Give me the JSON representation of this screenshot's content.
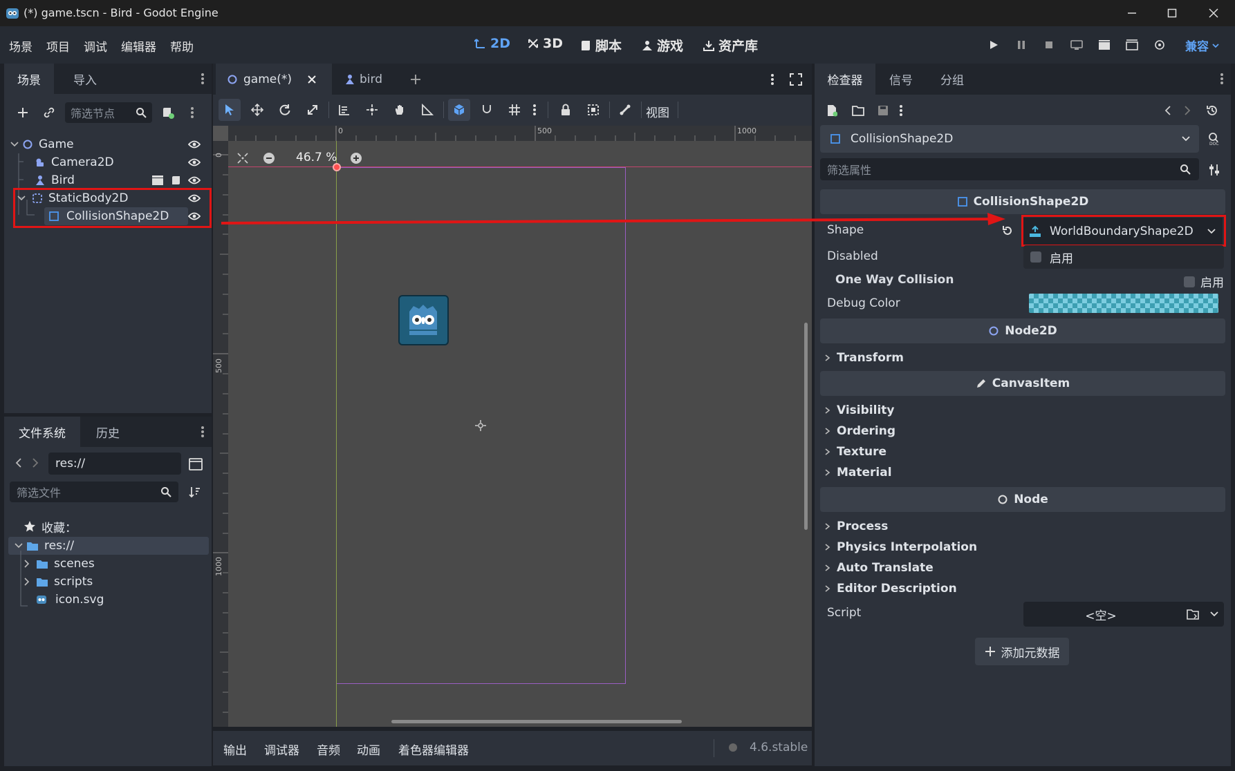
{
  "window": {
    "title": "(*) game.tscn - Bird - Godot Engine"
  },
  "menu": [
    "场景",
    "项目",
    "调试",
    "编辑器",
    "帮助"
  ],
  "workspaces": [
    {
      "label": "2D",
      "icon": "2d-icon",
      "active": true
    },
    {
      "label": "3D",
      "icon": "3d-icon",
      "active": false
    },
    {
      "label": "脚本",
      "icon": "script-icon",
      "active": false
    },
    {
      "label": "游戏",
      "icon": "game-icon",
      "active": false
    },
    {
      "label": "资产库",
      "icon": "assetlib-icon",
      "active": false
    }
  ],
  "renderer": "兼容",
  "scene_dock": {
    "tabs": [
      "场景",
      "导入"
    ],
    "filter_placeholder": "筛选节点",
    "nodes": [
      {
        "name": "Game",
        "icon": "node2d-icon"
      },
      {
        "name": "Camera2D",
        "icon": "camera2d-icon"
      },
      {
        "name": "Bird",
        "icon": "bird-scene-icon"
      },
      {
        "name": "StaticBody2D",
        "icon": "staticbody2d-icon"
      },
      {
        "name": "CollisionShape2D",
        "icon": "collisionshape2d-icon"
      }
    ]
  },
  "filesystem": {
    "tabs": [
      "文件系统",
      "历史"
    ],
    "path": "res://",
    "filter_placeholder": "筛选文件",
    "favorites": "收藏：",
    "items": [
      {
        "name": "res://",
        "type": "folder"
      },
      {
        "name": "scenes",
        "type": "folder"
      },
      {
        "name": "scripts",
        "type": "folder"
      },
      {
        "name": "icon.svg",
        "type": "file"
      }
    ]
  },
  "editor": {
    "tabs": [
      "game(*)",
      "bird"
    ],
    "view_menu": "视图",
    "zoom": "46.7 %",
    "ruler_top": [
      "0",
      "500",
      "1000"
    ],
    "ruler_left": [
      "0",
      "500",
      "1000"
    ],
    "bottom_tabs": [
      "输出",
      "调试器",
      "音频",
      "动画",
      "着色器编辑器"
    ],
    "version": "4.6.stable"
  },
  "inspector": {
    "tabs": [
      "检查器",
      "信号",
      "分组"
    ],
    "node_type": "CollisionShape2D",
    "filter_placeholder": "筛选属性",
    "sections": {
      "collision": "CollisionShape2D",
      "node2d": "Node2D",
      "canvasitem": "CanvasItem",
      "node": "Node"
    },
    "props": {
      "shape_label": "Shape",
      "shape_value": "WorldBoundaryShape2D",
      "disabled_label": "Disabled",
      "disabled_value": "启用",
      "oneway_label": "One Way Collision",
      "oneway_value": "启用",
      "debug_label": "Debug Color",
      "script_label": "Script",
      "script_value": "<空>"
    },
    "groups_node2d": [
      "Transform"
    ],
    "groups_canvas": [
      "Visibility",
      "Ordering",
      "Texture",
      "Material"
    ],
    "groups_node": [
      "Process",
      "Physics Interpolation",
      "Auto Translate",
      "Editor Description"
    ],
    "add_metadata": "添加元数据"
  },
  "colors": {
    "accent": "#5fa3f5",
    "highlight_red": "#e01515",
    "node2d_blue": "#8da5f3",
    "collision_blue": "#4b96f0"
  }
}
